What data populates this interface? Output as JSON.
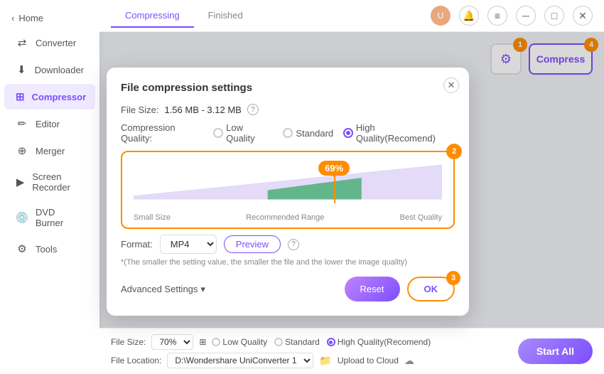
{
  "sidebar": {
    "back_label": "Home",
    "items": [
      {
        "id": "converter",
        "label": "Converter",
        "icon": "⇄"
      },
      {
        "id": "downloader",
        "label": "Downloader",
        "icon": "↓"
      },
      {
        "id": "compressor",
        "label": "Compressor",
        "icon": "⊞",
        "active": true
      },
      {
        "id": "editor",
        "label": "Editor",
        "icon": "✎"
      },
      {
        "id": "merger",
        "label": "Merger",
        "icon": "⊕"
      },
      {
        "id": "screen_recorder",
        "label": "Screen Recorder",
        "icon": "▶"
      },
      {
        "id": "dvd_burner",
        "label": "DVD Burner",
        "icon": "◉"
      },
      {
        "id": "tools",
        "label": "Tools",
        "icon": "⚙"
      }
    ]
  },
  "topbar": {
    "tabs": [
      {
        "id": "compressing",
        "label": "Compressing",
        "active": true
      },
      {
        "id": "finished",
        "label": "Finished",
        "active": false
      }
    ]
  },
  "actions": {
    "compress_label": "Compress",
    "step1": "1",
    "step4": "4"
  },
  "modal": {
    "title": "File compression settings",
    "file_size_label": "File Size:",
    "file_size_value": "1.56 MB - 3.12 MB",
    "compression_quality_label": "Compression Quality:",
    "quality_options": [
      {
        "id": "low",
        "label": "Low Quality",
        "checked": false
      },
      {
        "id": "standard",
        "label": "Standard",
        "checked": false
      },
      {
        "id": "high",
        "label": "High Quality(Recomend)",
        "checked": true
      }
    ],
    "chart": {
      "percentage": "69%",
      "small_size_label": "Small Size",
      "recommended_label": "Recommended Range",
      "best_quality_label": "Best Quality"
    },
    "format_label": "Format:",
    "format_value": "MP4",
    "preview_label": "Preview",
    "note": "*(The smaller the setting value, the smaller the file and the lower the image quality)",
    "advanced_label": "Advanced Settings",
    "reset_label": "Reset",
    "ok_label": "OK",
    "step2": "2",
    "step3": "3"
  },
  "bottom_bar": {
    "file_size_label": "File Size:",
    "file_size_pct": "70%",
    "quality_low": "Low Quality",
    "quality_standard": "Standard",
    "quality_high": "High Quality(Recomend)",
    "file_location_label": "File Location:",
    "file_location_value": "D:\\Wondershare UniConverter 1",
    "upload_cloud_label": "Upload to Cloud",
    "start_all_label": "Start All"
  }
}
